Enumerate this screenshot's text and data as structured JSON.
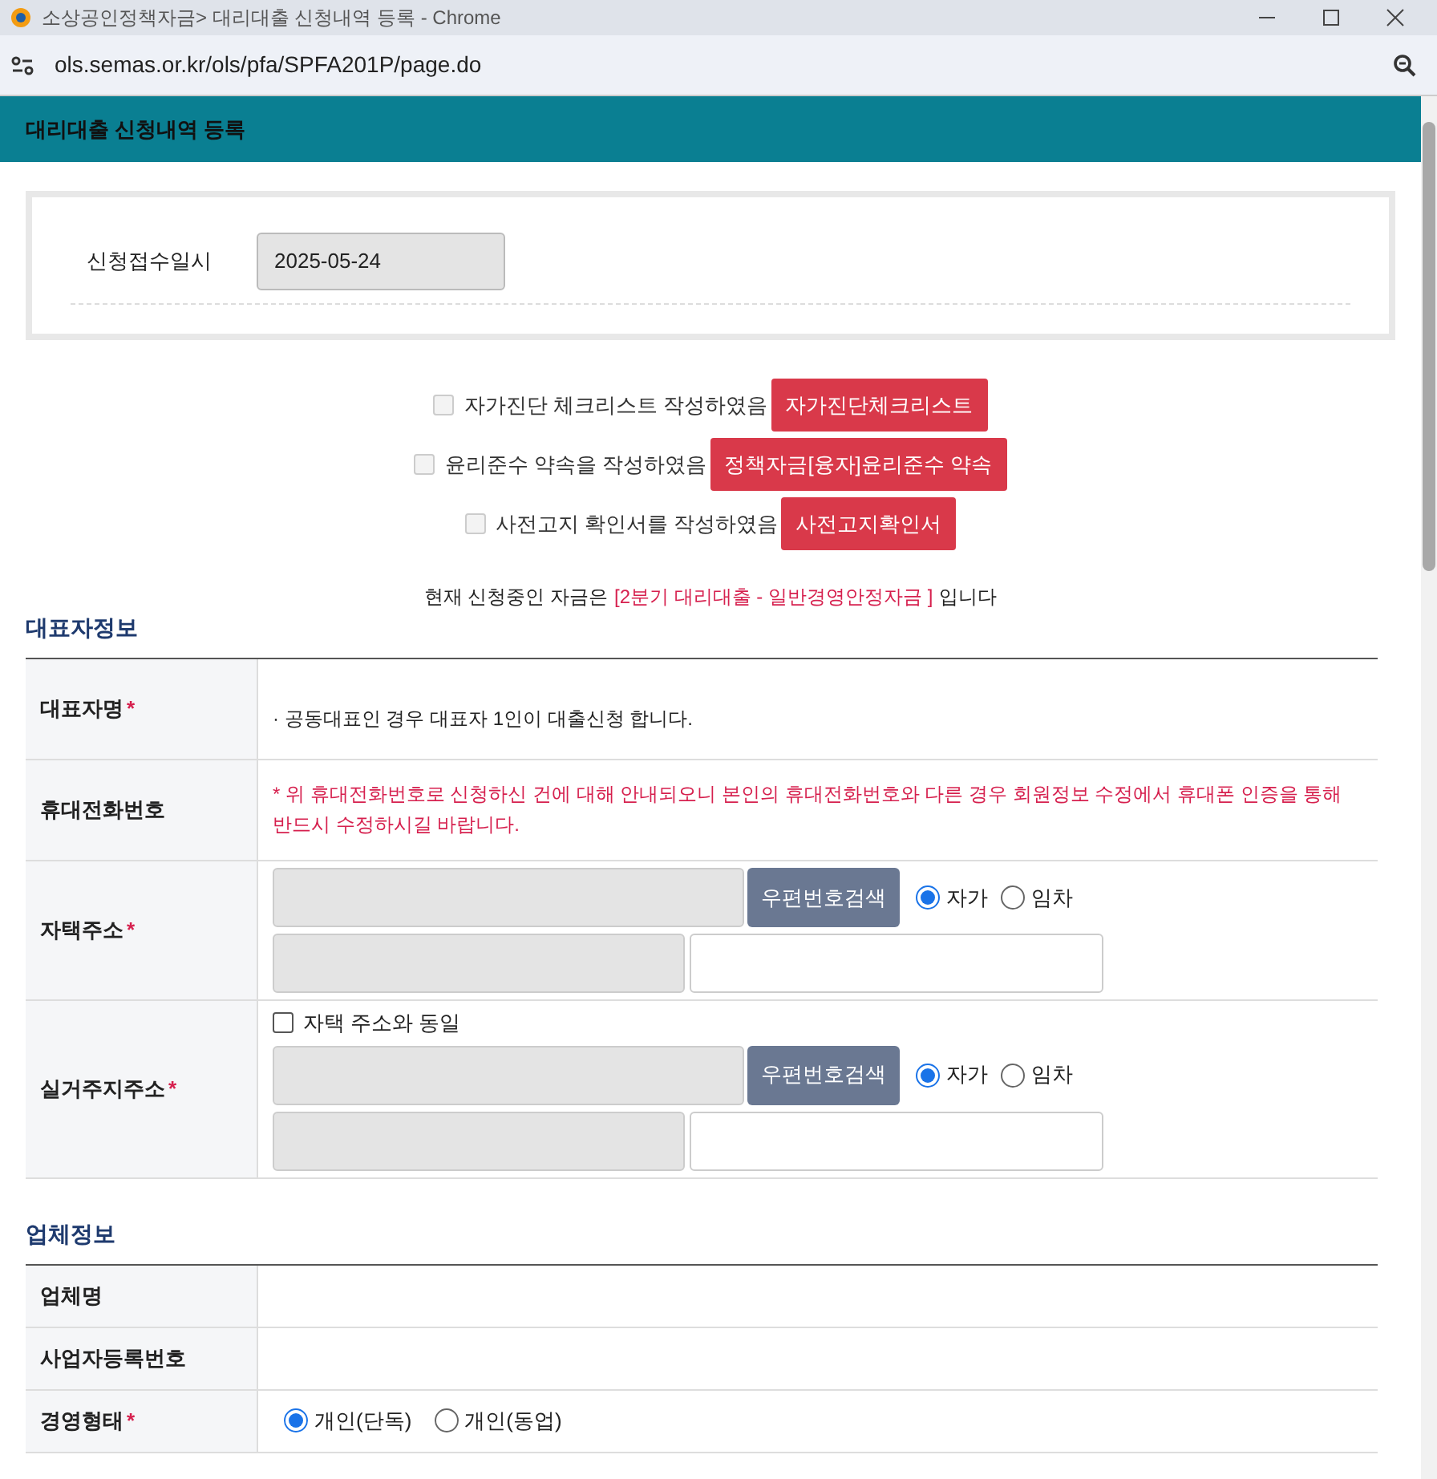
{
  "window": {
    "title": "소상공인정책자금> 대리대출 신청내역 등록 - Chrome",
    "url": "ols.semas.or.kr/ols/pfa/SPFA201P/page.do"
  },
  "header": {
    "title": "대리대출 신청내역 등록"
  },
  "date_box": {
    "label": "신청접수일시",
    "value": "2025-05-24"
  },
  "agreements": [
    {
      "label": "자가진단 체크리스트 작성하였음",
      "checked": false,
      "button": "자가진단체크리스트"
    },
    {
      "label": "윤리준수 약속을 작성하였음",
      "checked": false,
      "button": "정책자금[융자]윤리준수 약속"
    },
    {
      "label": "사전고지 확인서를 작성하였음",
      "checked": false,
      "button": "사전고지확인서"
    }
  ],
  "notice": {
    "prefix": "현재 신청중인 자금은",
    "highlight": "[2분기 대리대출 - 일반경영안정자금 ]",
    "suffix": "입니다"
  },
  "sections": [
    {
      "title": "대표자정보",
      "rows": [
        {
          "kind": "note",
          "label": "대표자명",
          "mark": "*",
          "text": "· 공동대표인 경우 대표자 1인이 대출신청 합니다."
        },
        {
          "kind": "warning",
          "label": "휴대전화번호",
          "text": "* 위 휴대전화번호로 신청하신 건에 대해 안내되오니 본인의 휴대전화번호와 다른 경우 회원정보 수정에서 휴대폰 인증을 통해 반드시 수정하시길 바랍니다."
        },
        {
          "kind": "address",
          "label": "자택주소",
          "mark": "*",
          "button": "우편번호검색",
          "options": [
            {
              "label": "자가",
              "selected": true
            },
            {
              "label": "임차",
              "selected": false
            }
          ]
        },
        {
          "kind": "address",
          "label": "실거주지주소",
          "mark": "*",
          "same_as": {
            "label": "자택 주소와 동일",
            "checked": false
          },
          "button": "우편번호검색",
          "options": [
            {
              "label": "자가",
              "selected": true
            },
            {
              "label": "임차",
              "selected": false
            }
          ]
        }
      ]
    },
    {
      "title": "업체정보",
      "rows": [
        {
          "kind": "empty",
          "label": "업체명"
        },
        {
          "kind": "empty",
          "label": "사업자등록번호"
        },
        {
          "kind": "radio",
          "label": "경영형태",
          "mark": "*",
          "options": [
            {
              "label": "개인(단독)",
              "selected": true
            },
            {
              "label": "개인(동업)",
              "selected": false
            }
          ]
        }
      ]
    }
  ]
}
